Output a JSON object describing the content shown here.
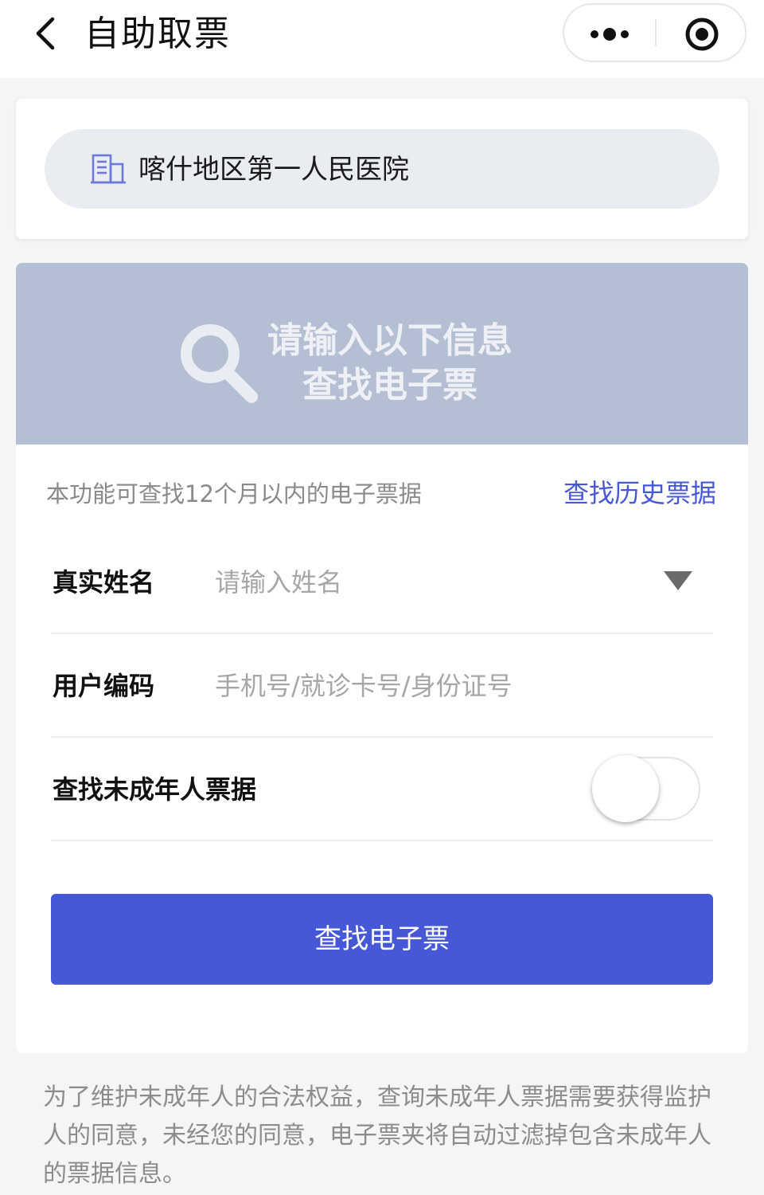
{
  "navbar": {
    "title": "自助取票",
    "back_icon": "chevron-left-icon",
    "more_icon": "more-dots-icon",
    "close_icon": "target-circle-icon"
  },
  "hospital": {
    "icon": "building-icon",
    "name": "喀什地区第一人民医院"
  },
  "banner": {
    "icon": "search-icon",
    "line1": "请输入以下信息",
    "line2": "查找电子票"
  },
  "form": {
    "scope_note": "本功能可查找12个月以内的电子票据",
    "history_link": "查找历史票据",
    "name_label": "真实姓名",
    "name_placeholder": "请输入姓名",
    "name_value": "",
    "code_label": "用户编码",
    "code_placeholder": "手机号/就诊卡号/身份证号",
    "code_value": "",
    "minor_label": "查找未成年人票据",
    "minor_toggle_on": false,
    "submit_label": "查找电子票"
  },
  "footer": {
    "notice": "为了维护未成年人的合法权益，查询未成年人票据需要获得监护人的同意，未经您的同意，电子票夹将自动过滤掉包含未成年人的票据信息。"
  },
  "colors": {
    "accent": "#4658d6",
    "link": "#4758d6",
    "banner_bg": "#b4bfd4",
    "page_bg": "#f4f5f7"
  }
}
